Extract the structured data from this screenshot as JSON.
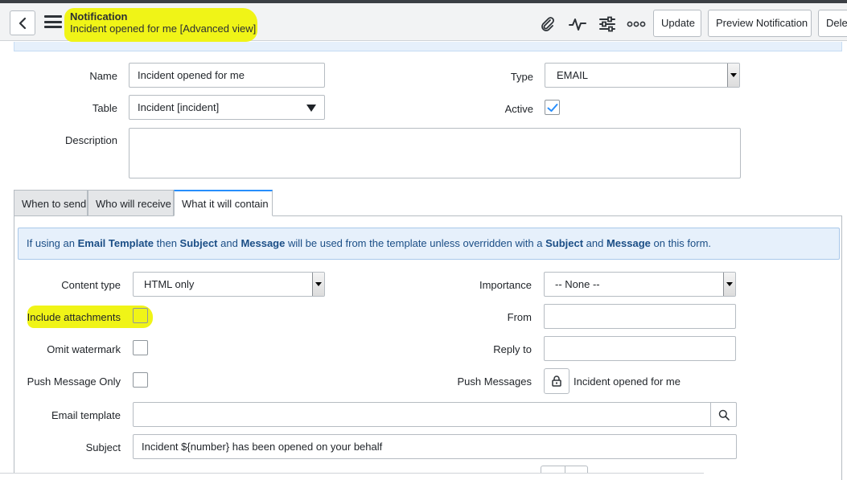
{
  "header": {
    "title": "Notification",
    "subtitle": "Incident opened for me [Advanced view]",
    "buttons": {
      "update": "Update",
      "preview": "Preview Notification",
      "delete": "Delet"
    },
    "icons": [
      "back-icon",
      "menu-icon",
      "paperclip-icon",
      "activity-icon",
      "settings-sliders-icon",
      "more-icon"
    ]
  },
  "form": {
    "name_label": "Name",
    "name_value": "Incident opened for me",
    "table_label": "Table",
    "table_value": "Incident [incident]",
    "description_label": "Description",
    "description_value": "",
    "type_label": "Type",
    "type_value": "EMAIL",
    "active_label": "Active",
    "active_checked": true
  },
  "tabs": [
    {
      "label": "When to send",
      "active": false
    },
    {
      "label": "Who will receive",
      "active": false
    },
    {
      "label": "What it will contain",
      "active": true
    }
  ],
  "notice": {
    "t1": "If using an ",
    "b1": "Email Template",
    "t2": " then ",
    "b2": "Subject",
    "t3": " and ",
    "b3": "Message",
    "t4": " will be used from the template unless overridden with a ",
    "b4": "Subject",
    "t5": " and ",
    "b5": "Message",
    "t6": " on this form."
  },
  "contain": {
    "content_type_label": "Content type",
    "content_type_value": "HTML only",
    "include_attachments_label": "Include attachments",
    "include_attachments_checked": false,
    "omit_watermark_label": "Omit watermark",
    "omit_watermark_checked": false,
    "push_only_label": "Push Message Only",
    "push_only_checked": false,
    "importance_label": "Importance",
    "importance_value": "-- None --",
    "from_label": "From",
    "from_value": "",
    "reply_to_label": "Reply to",
    "reply_to_value": "",
    "push_messages_label": "Push Messages",
    "push_messages_value": "Incident opened for me",
    "email_template_label": "Email template",
    "email_template_value": "",
    "subject_label": "Subject",
    "subject_value": "Incident ${number} has been opened on your behalf"
  },
  "colors": {
    "highlight": "#f0f417",
    "accent": "#278efc",
    "notice_bg": "#e6f0fb",
    "notice_text": "#1b4e86"
  }
}
